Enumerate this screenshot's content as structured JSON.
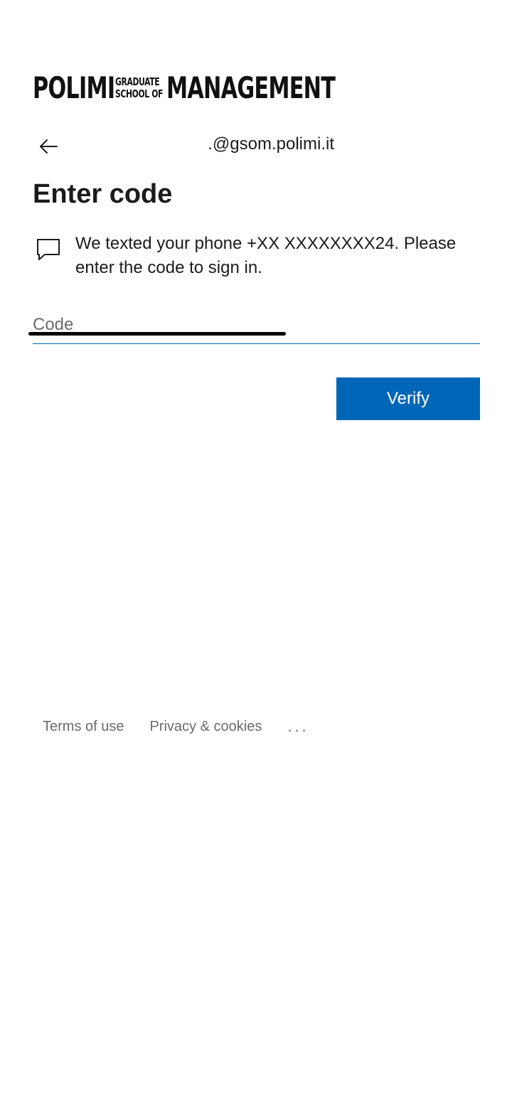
{
  "logo": {
    "part1": "POLIMI",
    "part2_line1": "GRADUATE",
    "part2_line2": "SCHOOL OF",
    "part3": "MANAGEMENT"
  },
  "identity": {
    "email": ".@gsom.polimi.it"
  },
  "page": {
    "title": "Enter code",
    "description": "We texted your phone +XX XXXXXXXX24. Please enter the code to sign in."
  },
  "code_field": {
    "placeholder": "Code",
    "value": ""
  },
  "actions": {
    "verify_label": "Verify"
  },
  "footer": {
    "terms_label": "Terms of use",
    "privacy_label": "Privacy & cookies",
    "more_label": "..."
  },
  "colors": {
    "accent": "#0067b8",
    "text": "#1b1b1b",
    "muted": "#6b6b6b"
  },
  "icons": {
    "back": "arrow-left-icon",
    "message": "chat-bubble-icon"
  }
}
